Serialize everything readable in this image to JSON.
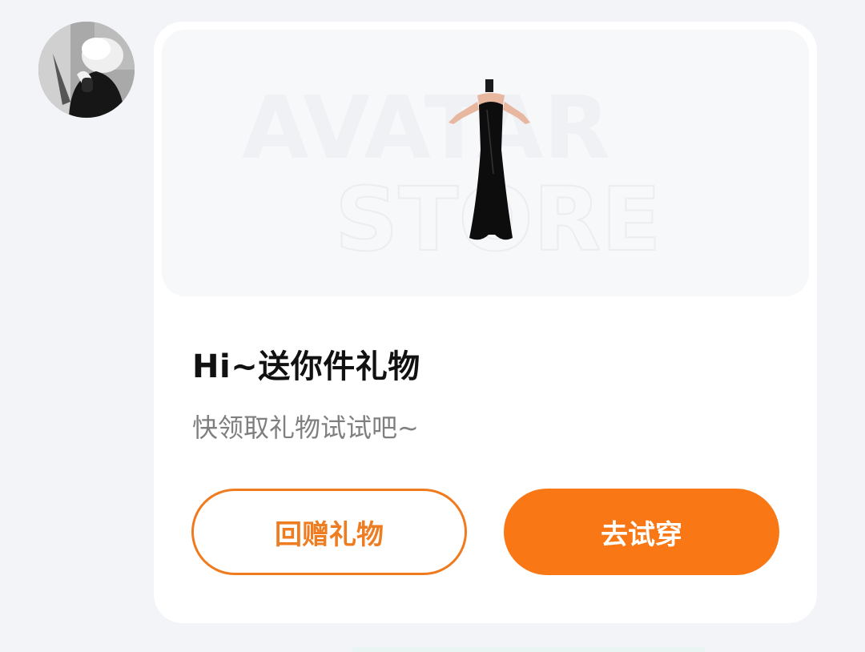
{
  "sender": {
    "avatar_icon": "user-avatar-photo"
  },
  "gift_card": {
    "banner": {
      "watermark_line1": "AVATAR",
      "watermark_line2": "STORE",
      "product_icon": "black-dress-icon"
    },
    "title": "Hi~送你件礼物",
    "subtitle": "快领取礼物试试吧~",
    "buttons": {
      "return_gift_label": "回赠礼物",
      "try_on_label": "去试穿"
    }
  },
  "colors": {
    "accent": "#f97714",
    "outline_border": "#f07a1e",
    "outline_text": "#ee7d22",
    "solid_text": "#ffffff",
    "title": "#111111",
    "subtitle": "#7f7f7f"
  }
}
